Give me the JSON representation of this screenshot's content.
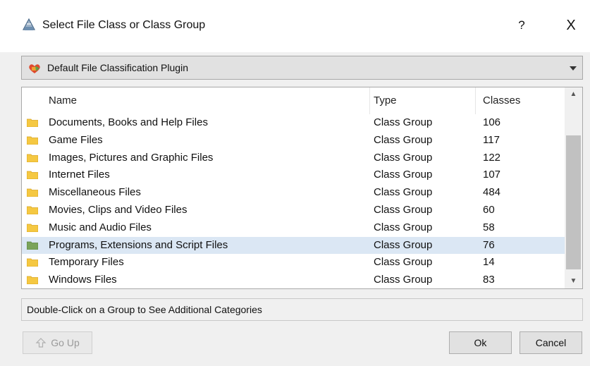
{
  "window": {
    "title": "Select File Class or Class Group",
    "help_label": "?",
    "close_label": "X"
  },
  "plugin_select": {
    "selected": "Default File Classification Plugin"
  },
  "grid": {
    "columns": {
      "name": "Name",
      "type": "Type",
      "classes": "Classes"
    },
    "rows": [
      {
        "name": "Documents, Books and Help Files",
        "type": "Class Group",
        "classes": "106",
        "selected": false
      },
      {
        "name": "Game Files",
        "type": "Class Group",
        "classes": "117",
        "selected": false
      },
      {
        "name": "Images, Pictures and Graphic Files",
        "type": "Class Group",
        "classes": "122",
        "selected": false
      },
      {
        "name": "Internet Files",
        "type": "Class Group",
        "classes": "107",
        "selected": false
      },
      {
        "name": "Miscellaneous Files",
        "type": "Class Group",
        "classes": "484",
        "selected": false
      },
      {
        "name": "Movies, Clips and Video Files",
        "type": "Class Group",
        "classes": "60",
        "selected": false
      },
      {
        "name": "Music and Audio Files",
        "type": "Class Group",
        "classes": "58",
        "selected": false
      },
      {
        "name": "Programs, Extensions and Script Files",
        "type": "Class Group",
        "classes": "76",
        "selected": true
      },
      {
        "name": "Temporary Files",
        "type": "Class Group",
        "classes": "14",
        "selected": false
      },
      {
        "name": "Windows Files",
        "type": "Class Group",
        "classes": "83",
        "selected": false
      }
    ]
  },
  "status": {
    "text": "Double-Click on a Group to See Additional Categories"
  },
  "buttons": {
    "go_up": "Go Up",
    "ok": "Ok",
    "cancel": "Cancel"
  },
  "colors": {
    "folder": "#f5c842",
    "folder_selected": "#7aa35a",
    "selection": "#dbe7f4"
  }
}
